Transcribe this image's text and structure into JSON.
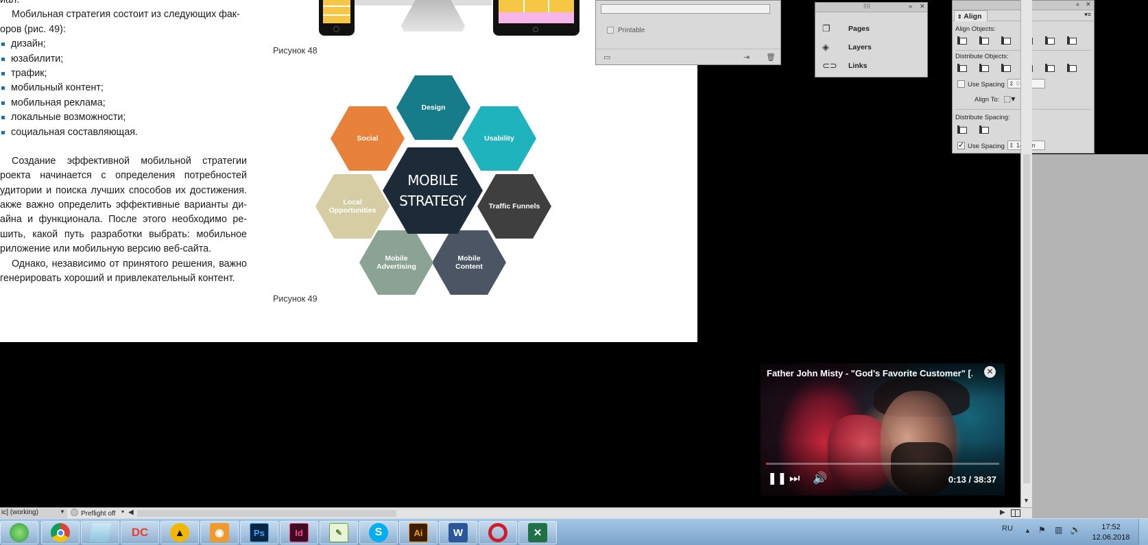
{
  "document": {
    "text_lines": {
      "l0": "иал.",
      "l1": "Мобильная стратегия состоит из следующих фак-",
      "l2": "оров (рис. 49):"
    },
    "bullets": [
      "дизайн;",
      "юзабилити;",
      "трафик;",
      "мобильный контент;",
      "мобильная реклама;",
      "локальные возможности;",
      "социальная составляющая."
    ],
    "paragraph1": [
      "Создание эффективной мобильной стратегии",
      "роекта начинается с определения потребностей",
      "удитории и поиска лучших способов их достижения.",
      "акже важно определить эффективные варианты ди-",
      "айна и функционала. После этого необходимо ре-",
      "шить, какой путь разработки выбрать: мобильное",
      "риложение или мобильную версию веб-сайта."
    ],
    "paragraph2": [
      "Однако, независимо от принятого решения, важно",
      "генерировать хороший и привлекательный контент."
    ],
    "caption48": "Рисунок 48",
    "caption49": "Рисунок 49"
  },
  "diagram": {
    "center_line1": "MOBILE",
    "center_line2": "STRATEGY",
    "nodes": {
      "design": {
        "label": "Design",
        "color": "#177c8a"
      },
      "usability": {
        "label": "Usability",
        "color": "#1fb3be"
      },
      "traffic": {
        "label": "Traffic Funnels",
        "color": "#3f3f40"
      },
      "content": {
        "label": "Mobile Content",
        "color": "#4b5564"
      },
      "advertising": {
        "label": "Mobile Advertising",
        "color": "#8aa394"
      },
      "local": {
        "label": "Local Opportunities",
        "color": "#d6cda4"
      },
      "social": {
        "label": "Social",
        "color": "#e8823a"
      }
    }
  },
  "layer_options_panel": {
    "printable_label": "Printable"
  },
  "pages_panel": {
    "items": [
      "Pages",
      "Layers",
      "Links"
    ]
  },
  "align_panel": {
    "tab": "Align",
    "align_objects": "Align Objects:",
    "distribute_objects": "Distribute Objects:",
    "use_spacing": "Use Spacing",
    "objects_spacing_value": "0 mm",
    "align_to": "Align To:",
    "distribute_spacing": "Distribute Spacing:",
    "spacing_value": "14 mm"
  },
  "status_bar": {
    "doc_state": "ic] (working)",
    "preflight": "Preflight off"
  },
  "player": {
    "title": "Father John Misty - \"God's Favorite Customer\" [...",
    "time": "0:13 / 38:37",
    "progress": 0.006,
    "accent": "#e52d27"
  },
  "taskbar": {
    "apps": [
      {
        "name": "globe",
        "label": ""
      },
      {
        "name": "chrome",
        "label": ""
      },
      {
        "name": "files",
        "label": ""
      },
      {
        "name": "dc",
        "label": "DC"
      },
      {
        "name": "warning",
        "label": ""
      },
      {
        "name": "eye",
        "label": ""
      },
      {
        "name": "photoshop",
        "label": "Ps"
      },
      {
        "name": "indesign",
        "label": "Id"
      },
      {
        "name": "notepad",
        "label": ""
      },
      {
        "name": "skype",
        "label": ""
      },
      {
        "name": "illustrator",
        "label": "Ai"
      },
      {
        "name": "word",
        "label": "W"
      },
      {
        "name": "opera",
        "label": ""
      },
      {
        "name": "excel",
        "label": ""
      }
    ],
    "language": "RU",
    "time": "17:52",
    "date": "12.06.2018"
  }
}
